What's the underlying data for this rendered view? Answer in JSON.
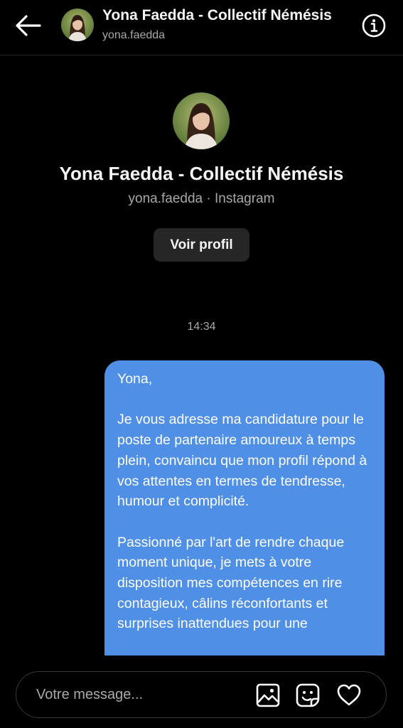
{
  "header": {
    "title": "Yona Faedda - Collectif Némésis",
    "username": "yona.faedda"
  },
  "profile": {
    "name": "Yona Faedda - Collectif Némésis",
    "handle_line": "yona.faedda · Instagram",
    "view_profile_label": "Voir profil"
  },
  "thread": {
    "timestamp": "14:34",
    "message": "Yona,\n\nJe vous adresse ma candidature pour le poste de partenaire amoureux à temps plein, convaincu que mon profil répond à vos attentes en termes de tendresse, humour et complicité.\n\nPassionné par l'art de rendre chaque moment unique, je mets à votre disposition mes compétences en rire contagieux, câlins réconfortants et surprises inattendues pour une"
  },
  "composer": {
    "placeholder": "Votre message..."
  },
  "icons": {
    "back": "arrow-left-icon",
    "info": "info-icon",
    "gallery": "image-icon",
    "sticker": "sticker-icon",
    "like": "heart-icon"
  },
  "colors": {
    "background": "#000000",
    "bubble": "#4f90e6",
    "secondary_text": "#a8a8a8",
    "button_bg": "#262626"
  }
}
